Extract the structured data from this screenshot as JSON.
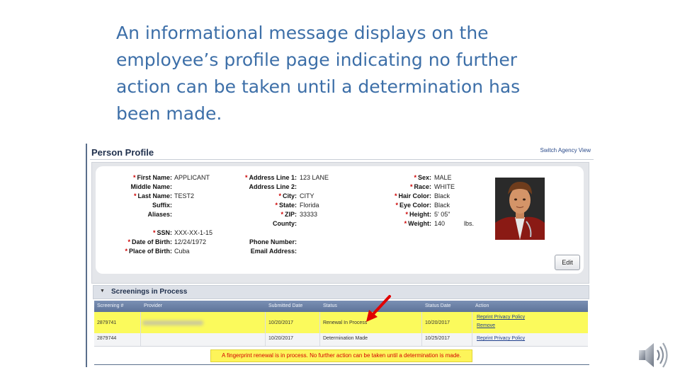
{
  "headline": "An informational message displays on the employee’s profile page indicating no further action can be taken until a determination has been made.",
  "profile": {
    "title": "Person Profile",
    "switch_link": "Switch Agency View",
    "edit_label": "Edit",
    "fields": {
      "first_name": {
        "label": "First Name:",
        "value": "APPLICANT",
        "required": "*"
      },
      "middle_name": {
        "label": "Middle Name:",
        "value": ""
      },
      "last_name": {
        "label": "Last Name:",
        "value": "TEST2",
        "required": "*"
      },
      "suffix": {
        "label": "Suffix:",
        "value": ""
      },
      "aliases": {
        "label": "Aliases:",
        "value": ""
      },
      "ssn": {
        "label": "SSN:",
        "value": "XXX-XX-1-15",
        "required": "*"
      },
      "dob": {
        "label": "Date of Birth:",
        "value": "12/24/1972",
        "required": "*"
      },
      "pob": {
        "label": "Place of Birth:",
        "value": "Cuba",
        "required": "*"
      },
      "address1": {
        "label": "Address Line 1:",
        "value": "123 LANE",
        "required": "*"
      },
      "address2": {
        "label": "Address Line 2:",
        "value": ""
      },
      "city": {
        "label": "City:",
        "value": "CITY",
        "required": "*"
      },
      "state": {
        "label": "State:",
        "value": "Florida",
        "required": "*"
      },
      "zip": {
        "label": "ZIP:",
        "value": "33333",
        "required": "*"
      },
      "county": {
        "label": "County:",
        "value": ""
      },
      "phone": {
        "label": "Phone Number:",
        "value": ""
      },
      "email": {
        "label": "Email Address:",
        "value": ""
      },
      "sex": {
        "label": "Sex:",
        "value": "MALE",
        "required": "*"
      },
      "race": {
        "label": "Race:",
        "value": "WHITE",
        "required": "*"
      },
      "hair": {
        "label": "Hair Color:",
        "value": "Black",
        "required": "*"
      },
      "eye": {
        "label": "Eye Color:",
        "value": "Black",
        "required": "*"
      },
      "height": {
        "label": "Height:",
        "value": "5' 05\"",
        "required": "*"
      },
      "weight": {
        "label": "Weight:",
        "value": "140",
        "unit": "lbs.",
        "required": "*"
      }
    }
  },
  "screenings": {
    "section_title": "Screenings in Process",
    "columns": [
      "Screening #",
      "Provider",
      "Submitted Date",
      "Status",
      "Status Date",
      "Action"
    ],
    "rows": [
      {
        "id": "2879741",
        "submitted": "10/20/2017",
        "status": "Renewal In Process",
        "status_date": "10/20/2017",
        "action1": "Reprint Privacy Policy",
        "action2": "Remove"
      },
      {
        "id": "2879744",
        "submitted": "10/20/2017",
        "status": "Determination Made",
        "status_date": "10/25/2017",
        "action1": "Reprint Privacy Policy"
      }
    ],
    "notice": "A fingerprint renewal is in process. No further action can be taken until a determination is made."
  },
  "colors": {
    "headline": "#3d6fa8",
    "highlight": "#fbfa5c",
    "notice_text": "#d40000",
    "arrow": "#e00000",
    "table_header": "#6a80a6"
  },
  "icons": [
    "arrow-pointer-icon",
    "speaker-icon"
  ]
}
